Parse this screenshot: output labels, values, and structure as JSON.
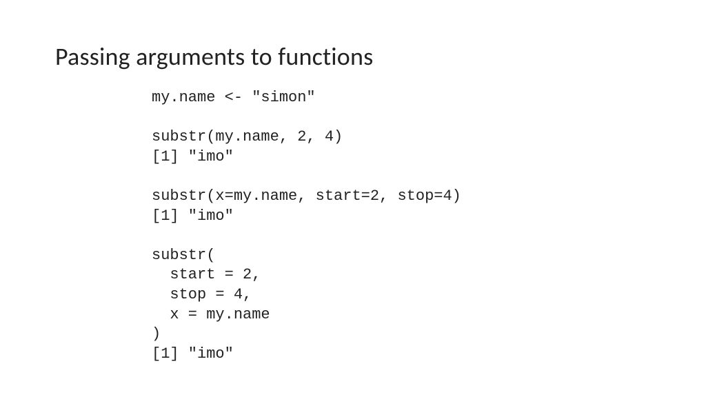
{
  "slide": {
    "title": "Passing arguments to functions",
    "code": "my.name <- \"simon\"\n\nsubstr(my.name, 2, 4)\n[1] \"imo\"\n\nsubstr(x=my.name, start=2, stop=4)\n[1] \"imo\"\n\nsubstr(\n  start = 2,\n  stop = 4,\n  x = my.name\n)\n[1] \"imo\""
  }
}
